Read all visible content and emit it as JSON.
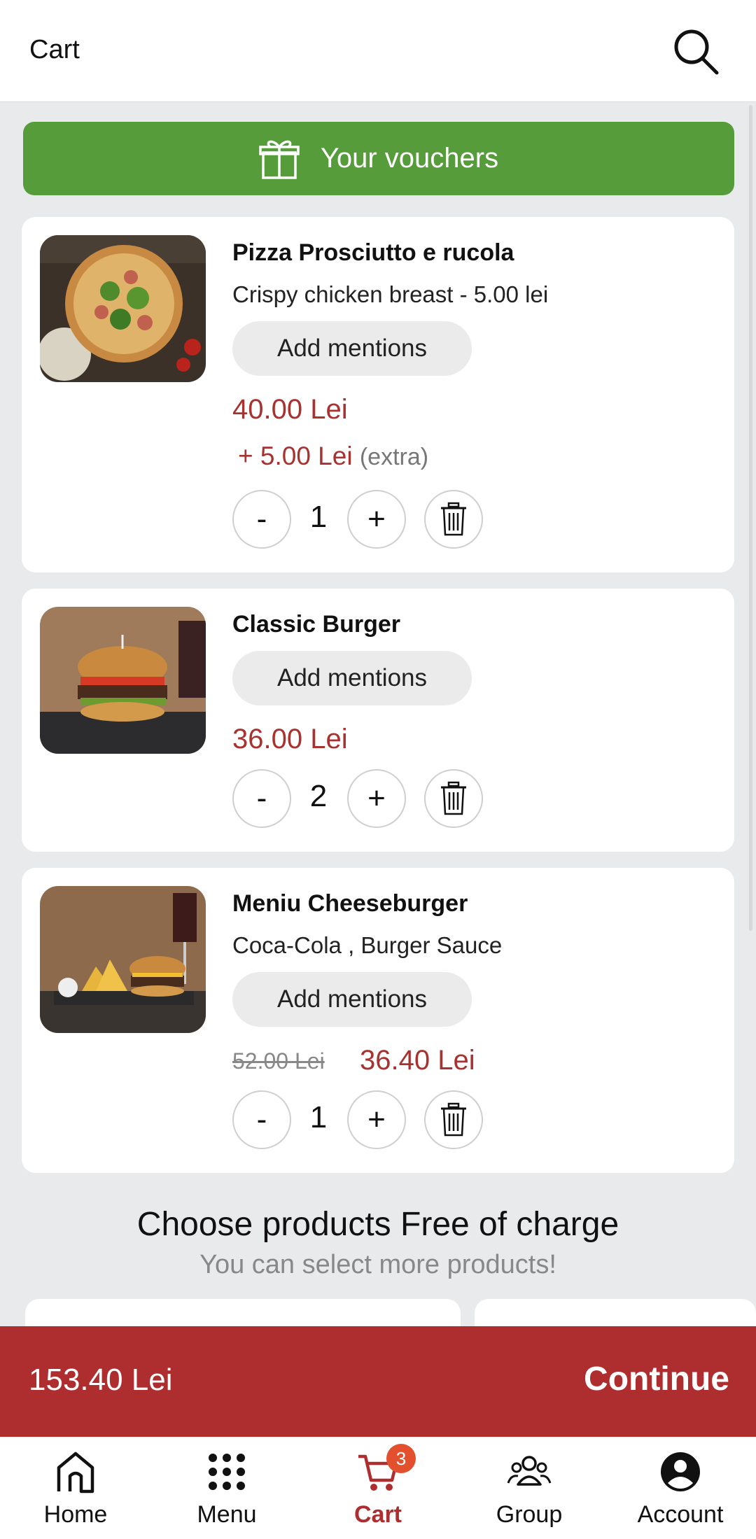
{
  "header": {
    "title": "Cart"
  },
  "vouchers": {
    "label": "Your vouchers"
  },
  "cart_items": [
    {
      "name": "Pizza Prosciutto e rucola",
      "options": "Crispy chicken breast  - 5.00 lei",
      "mentions_label": "Add mentions",
      "price": "40.00 Lei",
      "extra_price": "+ 5.00 Lei",
      "extra_note": "(extra)",
      "quantity": "1",
      "minus": "-",
      "plus": "+"
    },
    {
      "name": "Classic Burger",
      "mentions_label": "Add mentions",
      "price": "36.00 Lei",
      "quantity": "2",
      "minus": "-",
      "plus": "+"
    },
    {
      "name": "Meniu Cheeseburger",
      "options": "Coca-Cola , Burger Sauce",
      "mentions_label": "Add mentions",
      "old_price": "52.00 Lei",
      "price": "36.40 Lei",
      "quantity": "1",
      "minus": "-",
      "plus": "+"
    }
  ],
  "free_products": {
    "title": "Choose products Free of charge",
    "subtitle": "You can select more products!"
  },
  "checkout": {
    "total": "153.40 Lei",
    "continue_label": "Continue"
  },
  "bottom_nav": {
    "items": [
      {
        "label": "Home",
        "icon": "home-icon"
      },
      {
        "label": "Menu",
        "icon": "grid-icon"
      },
      {
        "label": "Cart",
        "icon": "cart-icon",
        "badge": "3"
      },
      {
        "label": "Group",
        "icon": "group-icon"
      },
      {
        "label": "Account",
        "icon": "account-icon"
      }
    ]
  },
  "colors": {
    "accent_green": "#579c3a",
    "brand_red": "#ae2e2f",
    "price_red": "#a8322f",
    "badge_orange": "#e2502e"
  }
}
